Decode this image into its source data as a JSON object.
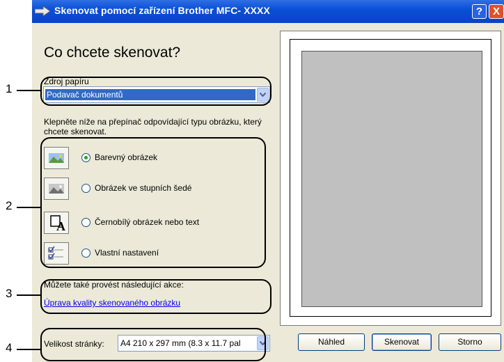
{
  "window": {
    "title": "Skenovat pomocí zařízení Brother MFC- XXXX",
    "help": "?",
    "close": "X"
  },
  "heading": "Co chcete skenovat?",
  "paper_source": {
    "label": "Zdroj papíru",
    "value": "Podavač dokumentů"
  },
  "instruction": "Klepněte níže na přepínač odpovídající typu obrázku, který chcete skenovat.",
  "options": [
    {
      "label": "Barevný obrázek",
      "selected": true
    },
    {
      "label": "Obrázek ve stupních šedé",
      "selected": false
    },
    {
      "label": "Černobílý obrázek nebo text",
      "selected": false
    },
    {
      "label": "Vlastní nastavení",
      "selected": false
    }
  ],
  "more_actions_label": "Můžete také provést následující akce:",
  "quality_link": "Úprava kvality skenovaného obrázku",
  "page_size": {
    "label": "Velikost stránky:",
    "value": "A4 210 x 297 mm (8.3 x 11.7 pal"
  },
  "buttons": {
    "preview": "Náhled",
    "scan": "Skenovat",
    "cancel": "Storno"
  },
  "callouts": [
    "1",
    "2",
    "3",
    "4"
  ],
  "colors": {
    "titlebar": "#0a4fd8",
    "window_bg": "#ece9d8",
    "selection": "#316ac5",
    "link": "#0000ee"
  }
}
